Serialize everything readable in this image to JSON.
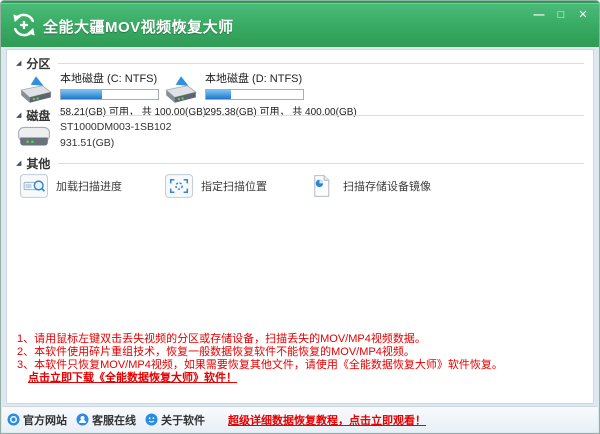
{
  "window": {
    "title": "全能大疆MOV视频恢复大师",
    "controls": {
      "minimize": "—",
      "maximize": "□",
      "close": "✕"
    }
  },
  "glyphs": {
    "section_expander": "◢"
  },
  "sections": {
    "partitions": {
      "label": "分区",
      "items": [
        {
          "name": "本地磁盘 (C: NTFS)",
          "capacity": "58.21(GB) 可用， 共 100.00(GB)",
          "used_percent": 42
        },
        {
          "name": "本地磁盘 (D: NTFS)",
          "capacity": "295.38(GB) 可用， 共 400.00(GB)",
          "used_percent": 26
        }
      ]
    },
    "disks": {
      "label": "磁盘",
      "items": [
        {
          "model": "ST1000DM003-1SB102",
          "capacity": "931.51(GB)"
        }
      ]
    },
    "others": {
      "label": "其他",
      "actions": [
        {
          "label": "加载扫描进度",
          "icon": "load-scan-progress-icon"
        },
        {
          "label": "指定扫描位置",
          "icon": "scan-location-icon"
        },
        {
          "label": "扫描存储设备镜像",
          "icon": "device-image-icon"
        }
      ]
    }
  },
  "notes": {
    "lines": [
      "1、请用鼠标左键双击丢失视频的分区或存储设备，扫描丢失的MOV/MP4视频数据。",
      "2、本软件使用碎片重组技术，恢复一般数据恢复软件不能恢复的MOV/MP4视频。",
      "3、本软件只恢复MOV/MP4视频，如果需要恢复其他文件，请使用《全能数据恢复大师》软件恢复。"
    ],
    "download_link": "点击立即下载《全能数据恢复大师》软件！"
  },
  "statusbar": {
    "links": [
      {
        "label": "官方网站",
        "icon": "website-icon"
      },
      {
        "label": "客服在线",
        "icon": "customer-service-icon"
      },
      {
        "label": "关于软件",
        "icon": "about-software-icon"
      }
    ],
    "tutorial_link": "超级详细数据恢复教程，点击立即观看！"
  },
  "colors": {
    "titlebar_green": "#3aad66",
    "accent_blue": "#2e86d4",
    "progress_fill_blue": "#2277cc",
    "warning_red": "#e60000"
  }
}
